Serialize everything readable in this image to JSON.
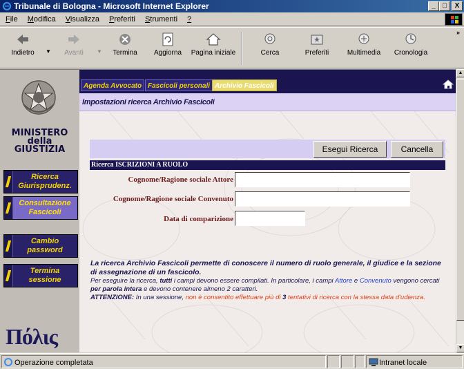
{
  "window": {
    "title": "Tribunale di Bologna - Microsoft Internet Explorer",
    "controls": {
      "minimize": "_",
      "maximize": "□",
      "close": "X"
    }
  },
  "menu": {
    "items": [
      {
        "key": "F",
        "rest": "ile"
      },
      {
        "key": "M",
        "rest": "odifica"
      },
      {
        "key": "V",
        "rest": "isualizza"
      },
      {
        "key": "P",
        "rest": "referiti"
      },
      {
        "key": "S",
        "rest": "trumenti"
      },
      {
        "key": "?",
        "rest": ""
      }
    ]
  },
  "toolbar": {
    "back": "Indietro",
    "forward": "Avanti",
    "stop": "Termina",
    "refresh": "Aggiorna",
    "home": "Pagina iniziale",
    "search": "Cerca",
    "favorites": "Preferiti",
    "media": "Multimedia",
    "history": "Cronologia"
  },
  "sidebar": {
    "ministry_line1": "MINISTERO",
    "ministry_line2": "della",
    "ministry_line3": "GIUSTIZIA",
    "nav": [
      {
        "line1": "Ricerca",
        "line2": "Giurisprudenz."
      },
      {
        "line1": "Consultazione",
        "line2": "Fascicoli"
      },
      {
        "line1": "Cambio",
        "line2": "password"
      },
      {
        "line1": "Termina",
        "line2": "sessione"
      }
    ],
    "logo_text": "Πόλις"
  },
  "tabs": {
    "items": [
      "Agenda Avvocato",
      "Fascicoli personali",
      "Archivio Fascicoli"
    ],
    "active": "Archivio Fascicoli"
  },
  "page": {
    "subheader": "Impostazioni ricerca Archivio Fascicoli",
    "search_button": "Esegui Ricerca",
    "cancel_button": "Cancella",
    "section_title": "Ricerca ISCRIZIONI A RUOLO"
  },
  "form": {
    "attore_label": "Cognome/Ragione sociale Attore",
    "attore_value": "",
    "convenuto_label": "Cognome/Ragione sociale Convenuto",
    "convenuto_value": "",
    "data_label": "Data di comparizione",
    "data_value": ""
  },
  "info": {
    "lead": "La ricerca Archivio Fascicoli permette di conoscere il numero di ruolo generale, il giudice e la sezione di assegnazione di un fascicolo.",
    "p1_a": "Per eseguire la ricerca, ",
    "p1_b": "tutti",
    "p1_c": " i campi devono essere compilati. In particolare, i campi ",
    "p1_d": "Attore",
    "p1_e": " e ",
    "p1_f": "Convenuto",
    "p1_g": " vengono cercati ",
    "p1_h": "per parola intera",
    "p1_i": " e devono contenere almeno 2 caratteri.",
    "p2_a": "ATTENZIONE:",
    "p2_b": " In una sessione, ",
    "p2_c": "non è consentito effettuare più di ",
    "p2_d": "3",
    "p2_e": " tentativi di ricerca con la stessa data d'udienza."
  },
  "status": {
    "left": "Operazione completata",
    "zone": "Intranet locale"
  },
  "colors": {
    "navy": "#1a1450",
    "gold": "#f2d300",
    "label_brown": "#6b1a1a",
    "link_blue": "#2340d0",
    "warning_red": "#e0401a"
  }
}
